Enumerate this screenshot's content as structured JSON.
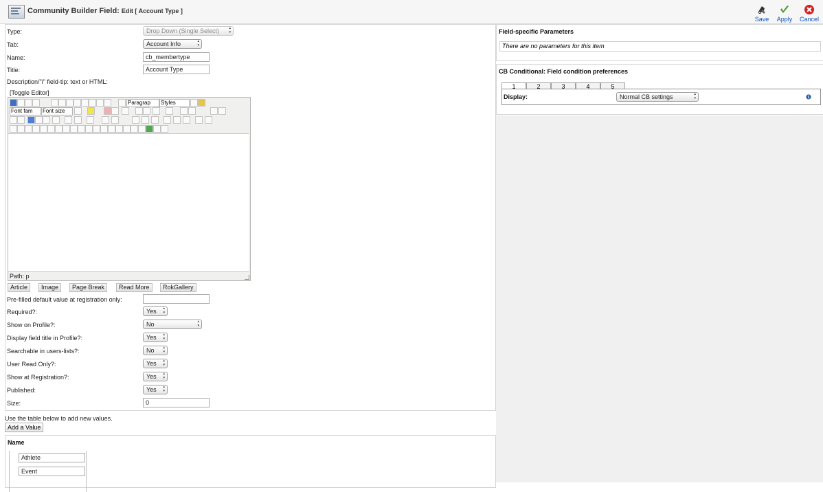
{
  "header": {
    "title": "Community Builder Field:",
    "subtitle": "Edit [ Account Type ]",
    "save_label": "Save",
    "apply_label": "Apply",
    "cancel_label": "Cancel"
  },
  "form": {
    "type": {
      "label": "Type:",
      "value": "Drop Down (Single Select)"
    },
    "tab": {
      "label": "Tab:",
      "value": "Account Info"
    },
    "name": {
      "label": "Name:",
      "value": "cb_membertype"
    },
    "title": {
      "label": "Title:",
      "value": "Account Type"
    },
    "description": {
      "label": "Description/\"i\" field-tip: text or HTML:"
    },
    "toggle_editor": "[Toggle Editor]",
    "editor": {
      "format_select": "Paragrap",
      "styles_select": "Styles",
      "font_family_select": "Font fam",
      "font_size_select": "Font size",
      "path": "Path: p"
    },
    "editor_buttons": [
      "Article",
      "Image",
      "Page Break",
      "Read More",
      "RokGallery"
    ],
    "prefilled": {
      "label": "Pre-filled default value at registration only:",
      "value": ""
    },
    "required": {
      "label": "Required?:",
      "value": "Yes"
    },
    "show_on_profile": {
      "label": "Show on Profile?:",
      "value": "No"
    },
    "display_title": {
      "label": "Display field title in Profile?:",
      "value": "Yes"
    },
    "searchable": {
      "label": "Searchable in users-lists?:",
      "value": "No"
    },
    "user_read_only": {
      "label": "User Read Only?:",
      "value": "Yes"
    },
    "show_at_registration": {
      "label": "Show at Registration?:",
      "value": "Yes"
    },
    "published": {
      "label": "Published:",
      "value": "Yes"
    },
    "size": {
      "label": "Size:",
      "value": "0"
    }
  },
  "values_section": {
    "instruction": "Use the table below to add new values.",
    "add_button": "Add a Value",
    "column_header": "Name",
    "values": [
      "Athlete",
      "Event"
    ]
  },
  "params": {
    "title": "Field-specific Parameters",
    "empty_text": "There are no parameters for this item"
  },
  "conditional": {
    "title": "CB Conditional: Field condition preferences",
    "tabs": [
      "1",
      "2",
      "3",
      "4",
      "5"
    ],
    "display_label": "Display:",
    "display_value": "Normal CB settings"
  }
}
